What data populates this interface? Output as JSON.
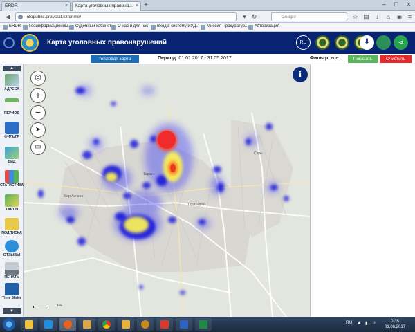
{
  "browser": {
    "tabs": [
      {
        "label": "ERDR"
      },
      {
        "label": "Карта уголовных правона..."
      }
    ],
    "url": "infopublic.pravstat.kz/crime/",
    "search_placeholder": "Google",
    "bookmarks": [
      {
        "label": "ERDR"
      },
      {
        "label": "Геоинформационны..."
      },
      {
        "label": "Судебный кабинет"
      },
      {
        "label": "О нас и для нас"
      },
      {
        "label": "Вход в систему ИУД..."
      },
      {
        "label": "Миссия Прокуратур..."
      },
      {
        "label": "Авторизация"
      }
    ]
  },
  "header": {
    "title": "Карта уголовных правонарушений",
    "lang": "RU"
  },
  "toolbar": {
    "heat_map_label": "тепловая карта",
    "period_label": "Период:",
    "period_value": "01.01.2017 - 31.05.2017",
    "filter_label": "Фильтр:",
    "filter_value": "все",
    "show_label": "Показать",
    "clear_label": "Очистить"
  },
  "sidebar": {
    "items": [
      {
        "label": "АДРЕСА"
      },
      {
        "label": "ПЕРИОД"
      },
      {
        "label": "ФИЛЬТР"
      },
      {
        "label": "ВИД"
      },
      {
        "label": "СТАТИСТИКА"
      },
      {
        "label": "КАРТЫ"
      },
      {
        "label": "ПОДПИСКА"
      },
      {
        "label": "ОТЗЫВЫ"
      },
      {
        "label": "ПЕЧАТЬ"
      },
      {
        "label": "Time Slider"
      }
    ]
  },
  "map": {
    "info_label": "i",
    "labels": [
      {
        "text": "Тараз"
      },
      {
        "text": "Тараз-уран"
      },
      {
        "text": "Сулы"
      },
      {
        "text": "Мир-Азнана"
      }
    ],
    "scale_label": "1км"
  },
  "taskbar": {
    "lang": "RU",
    "time": "0:35",
    "date": "01.06.2017"
  }
}
